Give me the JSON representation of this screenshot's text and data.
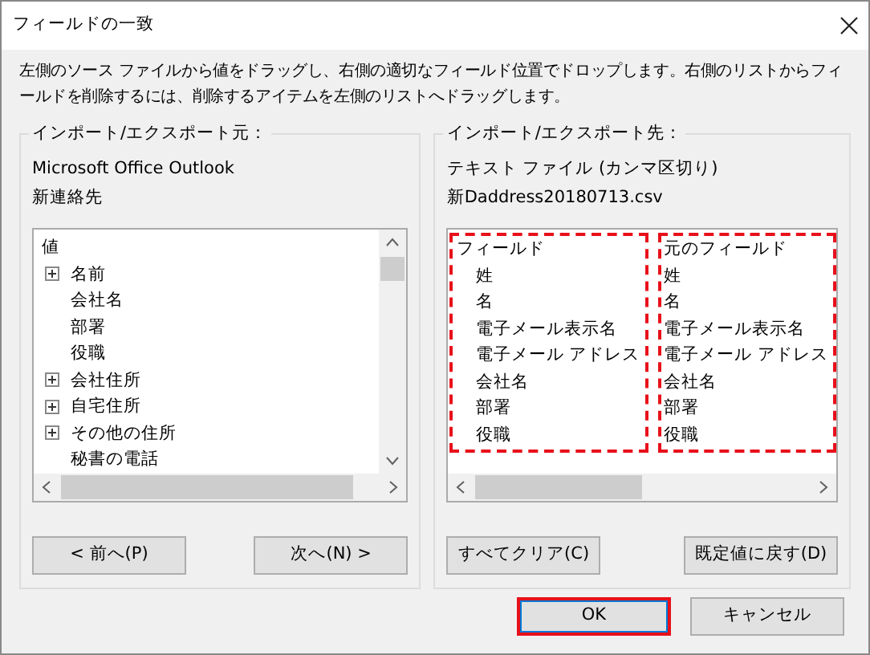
{
  "window": {
    "title": "フィールドの一致"
  },
  "instructions": "左側のソース ファイルから値をドラッグし、右側の適切なフィールド位置でドロップします。右側のリストからフィールドを削除するには、削除するアイテムを左側のリストへドラッグします。",
  "source": {
    "legend": "インポート/エクスポート元：",
    "lines": [
      "Microsoft Office Outlook",
      "新連絡先"
    ],
    "list": {
      "header": "値",
      "items": [
        {
          "label": "名前",
          "expandable": true
        },
        {
          "label": "会社名",
          "expandable": false
        },
        {
          "label": "部署",
          "expandable": false
        },
        {
          "label": "役職",
          "expandable": false
        },
        {
          "label": "会社住所",
          "expandable": true
        },
        {
          "label": "自宅住所",
          "expandable": true
        },
        {
          "label": "その他の住所",
          "expandable": true
        },
        {
          "label": "秘書の電話",
          "expandable": false
        }
      ]
    },
    "buttons": [
      {
        "label": "< 前へ(P)"
      },
      {
        "label": "次へ(N) >"
      }
    ]
  },
  "target": {
    "legend": "インポート/エクスポート先：",
    "lines": [
      "テキスト ファイル (カンマ区切り)",
      "新Daddress20180713.csv"
    ],
    "columns": [
      {
        "header": "フィールド",
        "highlighted": true,
        "indented": true,
        "rows": [
          "姓",
          "名",
          "電子メール表示名",
          "電子メール アドレス",
          "会社名",
          "部署",
          "役職"
        ]
      },
      {
        "header": "元のフィールド",
        "highlighted": true,
        "indented": false,
        "rows": [
          "姓",
          "名",
          "電子メール表示名",
          "電子メール アドレス",
          "会社名",
          "部署",
          "役職"
        ]
      }
    ],
    "buttons": [
      {
        "label": "すべてクリア(C)"
      },
      {
        "label": "既定値に戻す(D)"
      }
    ]
  },
  "footer_buttons": [
    {
      "label": "OK",
      "highlighted": true
    },
    {
      "label": "キャンセル",
      "highlighted": false
    }
  ]
}
